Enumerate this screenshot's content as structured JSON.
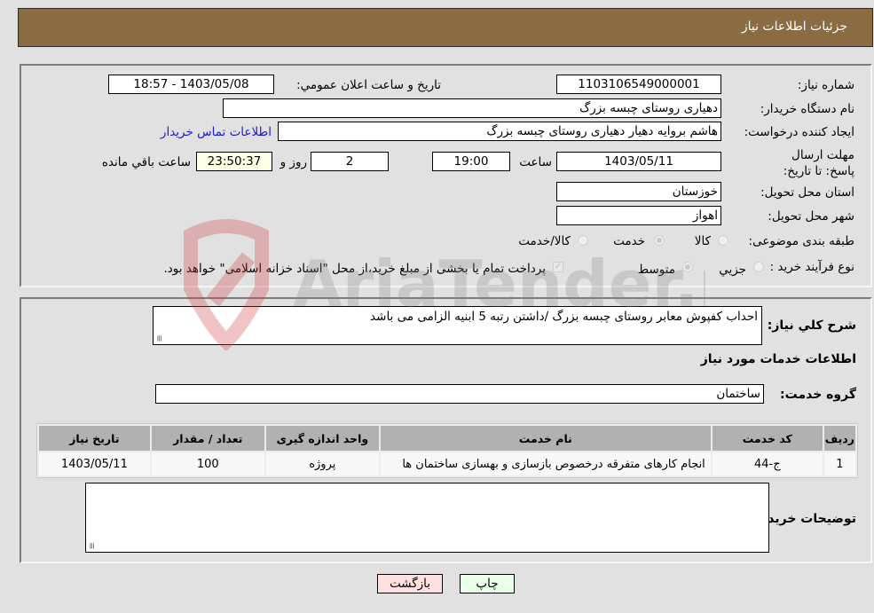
{
  "header": {
    "title": "جزئیات اطلاعات نیاز"
  },
  "form": {
    "need_number_label": "شماره نیاز:",
    "need_number": "1103106549000001",
    "announce_label": "تاریخ و ساعت اعلان عمومي:",
    "announce_value": "1403/05/08 - 18:57",
    "buyer_org_label": "نام دستگاه خریدار:",
    "buyer_org": "دهیاری روستای چبسه بزرگ",
    "creator_label": "ایجاد کننده درخواست:",
    "creator": "هاشم بروایه دهیار دهیاری روستای چبسه بزرگ",
    "contact_link": "اطلاعات تماس خریدار",
    "deadline_label": "مهلت ارسال پاسخ: تا تاریخ:",
    "deadline_date": "1403/05/11",
    "hour_label": "ساعت",
    "deadline_time": "19:00",
    "days_value": "2",
    "days_label": "روز و",
    "remaining_time": "23:50:37",
    "remaining_label": "ساعت باقي مانده",
    "province_label": "استان محل تحویل:",
    "province": "خوزستان",
    "city_label": "شهر محل تحویل:",
    "city": "اهواز",
    "category_label": "طبقه بندی موضوعی:",
    "category_options": [
      {
        "label": "کالا",
        "checked": false
      },
      {
        "label": "خدمت",
        "checked": true
      },
      {
        "label": "کالا/خدمت",
        "checked": false
      }
    ],
    "process_label": "نوع فرآیند خرید :",
    "process_options": [
      {
        "label": "جزيي",
        "checked": false
      },
      {
        "label": "متوسط",
        "checked": true
      }
    ],
    "treasury_checkbox_label": "پرداخت تمام یا بخشی از مبلغ خرید،از محل \"اسناد خزانه اسلامی\" خواهد بود.",
    "treasury_checked": true
  },
  "details": {
    "description_label": "شرح کلي نیاز:",
    "description": "احداب کفپوش معابر روستای چبسه بزرگ /داشتن رتبه 5 ابنیه الزامی می باشد",
    "services_heading": "اطلاعات خدمات مورد نیاز",
    "service_group_label": "گروه خدمت:",
    "service_group": "ساختمان",
    "table": {
      "headers": [
        "ردیف",
        "کد خدمت",
        "نام خدمت",
        "واحد اندازه گیری",
        "تعداد / مقدار",
        "تاریخ نیاز"
      ],
      "rows": [
        [
          "1",
          "ج-44",
          "انجام کارهای متفرقه درخصوص بازسازی و بهسازی ساختمان ها",
          "پروژه",
          "100",
          "1403/05/11"
        ]
      ]
    },
    "buyer_notes_label": "توضیحات خریدار:",
    "buyer_notes": ""
  },
  "buttons": {
    "print": "چاپ",
    "back": "بازگشت"
  },
  "watermark": {
    "text": "AriaTender.neT"
  },
  "colors": {
    "header_bg": "#8b6c42",
    "print_bg": "#eaffea",
    "back_bg": "#ffe0e0",
    "link": "#1a1ad9"
  }
}
